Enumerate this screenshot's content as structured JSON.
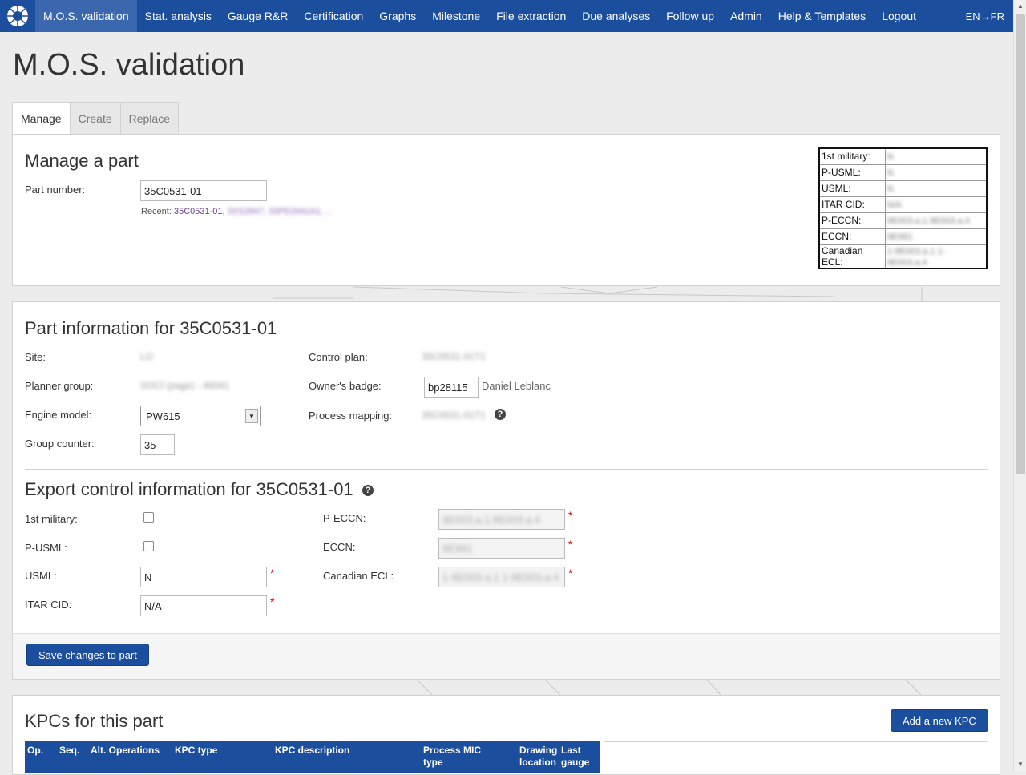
{
  "nav": {
    "items": [
      "M.O.S. validation",
      "Stat. analysis",
      "Gauge R&R",
      "Certification",
      "Graphs",
      "Milestone",
      "File extraction",
      "Due analyses",
      "Follow up",
      "Admin",
      "Help & Templates",
      "Logout"
    ],
    "active_index": 0,
    "lang": "EN→FR"
  },
  "page_title": "M.O.S. validation",
  "tabs": [
    "Manage",
    "Create",
    "Replace"
  ],
  "manage": {
    "title": "Manage a part",
    "part_number_label": "Part number:",
    "part_number_value": "35C0531-01",
    "recent_label": "Recent:",
    "recent_link": "35C0531-01",
    "recent_sep": ",",
    "recent_link_blurred": "3XS2847, 33PE2941A1, ...",
    "summary": [
      {
        "key": "1st military:",
        "value": "N"
      },
      {
        "key": "P-USML:",
        "value": "N"
      },
      {
        "key": "USML:",
        "value": "N"
      },
      {
        "key": "ITAR CID:",
        "value": "N/A"
      },
      {
        "key": "P-ECCN:",
        "value": "9E003.a.1.9E003.a.4"
      },
      {
        "key": "ECCN:",
        "value": "9E991"
      },
      {
        "key": "Canadian ECL:",
        "value": "1-9E003.a.1 1-9E003.a.4"
      }
    ]
  },
  "part_info": {
    "title": "Part information for 35C0531-01",
    "site_label": "Site:",
    "site_value": "LO",
    "planner_label": "Planner group:",
    "planner_value": "SOCI (page) - 46041",
    "engine_label": "Engine model:",
    "engine_value": "PW615",
    "group_counter_label": "Group counter:",
    "group_counter_value": "35",
    "control_plan_label": "Control plan:",
    "control_plan_value": "35C0531-01T1",
    "owner_label": "Owner's badge:",
    "owner_badge": "bp28115",
    "owner_name": "Daniel Leblanc",
    "process_mapping_label": "Process mapping:",
    "process_mapping_value": "35C0531-01T1"
  },
  "export": {
    "title": "Export control information for 35C0531-01",
    "first_military_label": "1st military:",
    "pusml_label": "P-USML:",
    "usml_label": "USML:",
    "usml_value": "N",
    "itar_label": "ITAR CID:",
    "itar_value": "N/A",
    "peccn_label": "P-ECCN:",
    "peccn_value": "9E003.a.1.9E003.a.4",
    "eccn_label": "ECCN:",
    "eccn_value": "9E991",
    "canadian_label": "Canadian ECL:",
    "canadian_value": "1-9E003.a.1 1-9E003.a.4",
    "required_mark": "*",
    "help_glyph": "?"
  },
  "save_button": "Save changes to part",
  "kpc": {
    "title": "KPCs for this part",
    "add_button": "Add a new KPC",
    "columns": [
      "Op.",
      "Seq.",
      "Alt. Operations",
      "KPC type",
      "KPC description",
      "Process type",
      "MIC",
      "Drawing location",
      "Last gauge"
    ]
  },
  "colors": {
    "nav": "#1b4e9d",
    "nav_active": "#3a67ad",
    "required": "#dd0000"
  }
}
